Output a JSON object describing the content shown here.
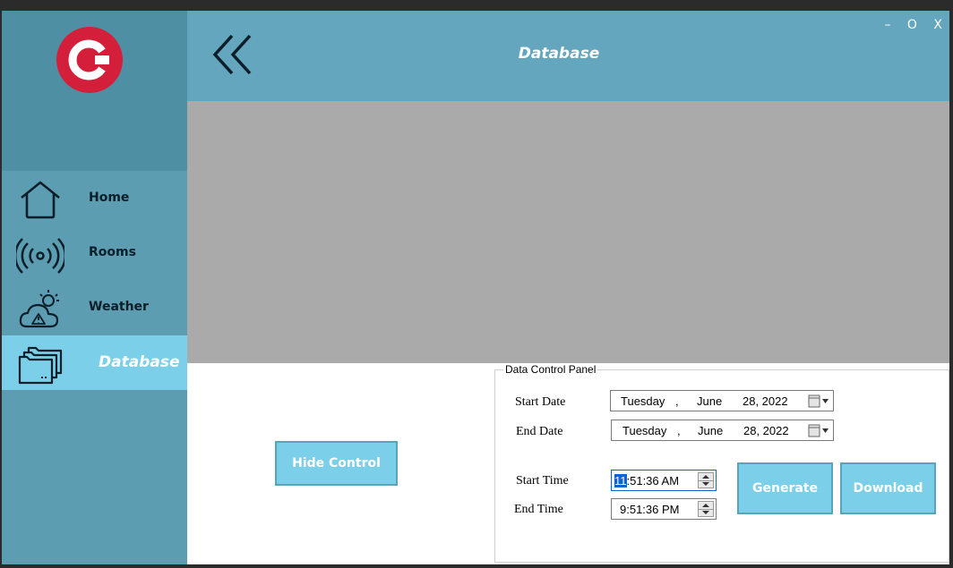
{
  "window": {
    "title": "Database",
    "minimize": "–",
    "maximize": "O",
    "close": "X"
  },
  "colors": {
    "sidebar": "#5c9db2",
    "header": "#64a6be",
    "active": "#7ccfe9",
    "logo_red": "#d41f3a"
  },
  "sidebar": {
    "items": [
      {
        "label": "Home",
        "icon": "home-icon"
      },
      {
        "label": "Rooms",
        "icon": "wireless-signal-icon"
      },
      {
        "label": "Weather",
        "icon": "weather-alert-icon"
      },
      {
        "label": "Database",
        "icon": "folders-icon",
        "active": true
      }
    ]
  },
  "controls": {
    "hide_label": "Hide Control",
    "panel_title": "Data Control Panel",
    "start_date_label": "Start Date",
    "end_date_label": "End Date",
    "start_time_label": "Start Time",
    "end_time_label": "End Time",
    "start_date": {
      "weekday": "Tuesday",
      "sep": ",",
      "month": "June",
      "day_year": "28, 2022"
    },
    "end_date": {
      "weekday": "Tuesday",
      "sep": ",",
      "month": "June",
      "day_year": "28, 2022"
    },
    "start_time": {
      "hour": "11",
      "rest": ":51:36 AM"
    },
    "end_time": {
      "value": "9:51:36 PM"
    },
    "generate_label": "Generate",
    "download_label": "Download"
  }
}
